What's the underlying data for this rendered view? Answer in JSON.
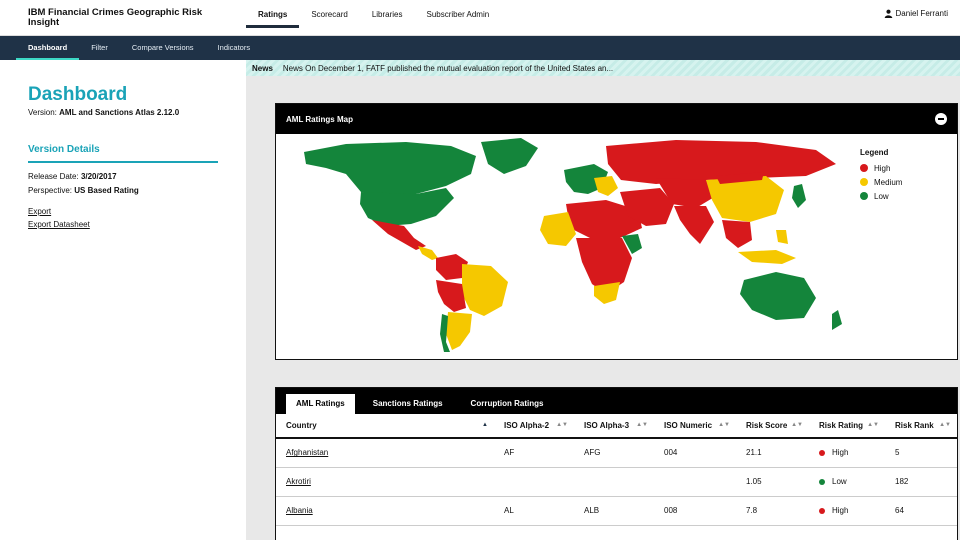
{
  "app": {
    "title": "IBM Financial Crimes Geographic Risk Insight"
  },
  "top_nav": [
    "Ratings",
    "Scorecard",
    "Libraries",
    "Subscriber Admin"
  ],
  "user": {
    "name": "Daniel Ferranti",
    "icon": "user-icon"
  },
  "sub_nav": [
    "Dashboard",
    "Filter",
    "Compare Versions",
    "Indicators"
  ],
  "sidebar": {
    "title": "Dashboard",
    "version_label": "Version:",
    "version_value": "AML and Sanctions Atlas 2.12.0",
    "details_heading": "Version Details",
    "release_label": "Release Date:",
    "release_value": "3/20/2017",
    "perspective_label": "Perspective:",
    "perspective_value": "US Based Rating",
    "links": [
      "Export",
      "Export Datasheet"
    ]
  },
  "news": {
    "label": "News",
    "text": "News On December 1, FATF published the mutual evaluation report of the United States an..."
  },
  "map": {
    "title": "AML Ratings Map",
    "legend_title": "Legend",
    "legend": [
      {
        "label": "High",
        "color": "#d7191c"
      },
      {
        "label": "Medium",
        "color": "#f5c800"
      },
      {
        "label": "Low",
        "color": "#14853b"
      }
    ]
  },
  "table": {
    "tabs": [
      "AML Ratings",
      "Sanctions Ratings",
      "Corruption Ratings"
    ],
    "headers": [
      "Country",
      "ISO Alpha-2",
      "ISO Alpha-3",
      "ISO Numeric",
      "Risk Score",
      "Risk Rating",
      "Risk Rank"
    ],
    "rows": [
      {
        "country": "Afghanistan",
        "a2": "AF",
        "a3": "AFG",
        "num": "004",
        "score": "21.1",
        "rating": "High",
        "color": "#d7191c",
        "rank": "5"
      },
      {
        "country": "Akrotiri",
        "a2": "",
        "a3": "",
        "num": "",
        "score": "1.05",
        "rating": "Low",
        "color": "#14853b",
        "rank": "182"
      },
      {
        "country": "Albania",
        "a2": "AL",
        "a3": "ALB",
        "num": "008",
        "score": "7.8",
        "rating": "High",
        "color": "#d7191c",
        "rank": "64"
      }
    ]
  }
}
